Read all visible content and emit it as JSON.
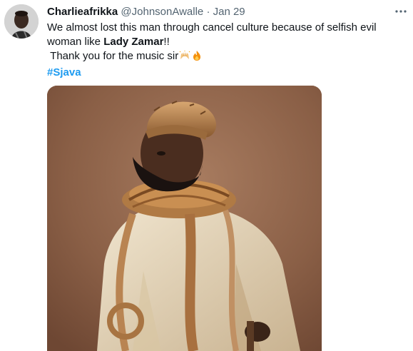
{
  "tweet": {
    "author_name": "Charlieafrikka",
    "author_handle": "@JohnsonAwalle",
    "separator": "·",
    "date": "Jan 29",
    "text_line1": "We almost lost this man through cancel culture because of selfish evil",
    "text_line2_pre": "woman like ",
    "text_line2_bold": "Lady Zamar",
    "text_line2_post": "!!",
    "text_line3": "Thank you for the music  sir",
    "hashtag": "#Sjava",
    "more_icon": "more-horizontal-icon",
    "emojis": [
      "raising-hands-emoji",
      "fire-emoji"
    ]
  },
  "colors": {
    "text": "#0f1419",
    "secondary": "#536471",
    "link": "#1d9bf0",
    "media_background": "#8b6148"
  }
}
